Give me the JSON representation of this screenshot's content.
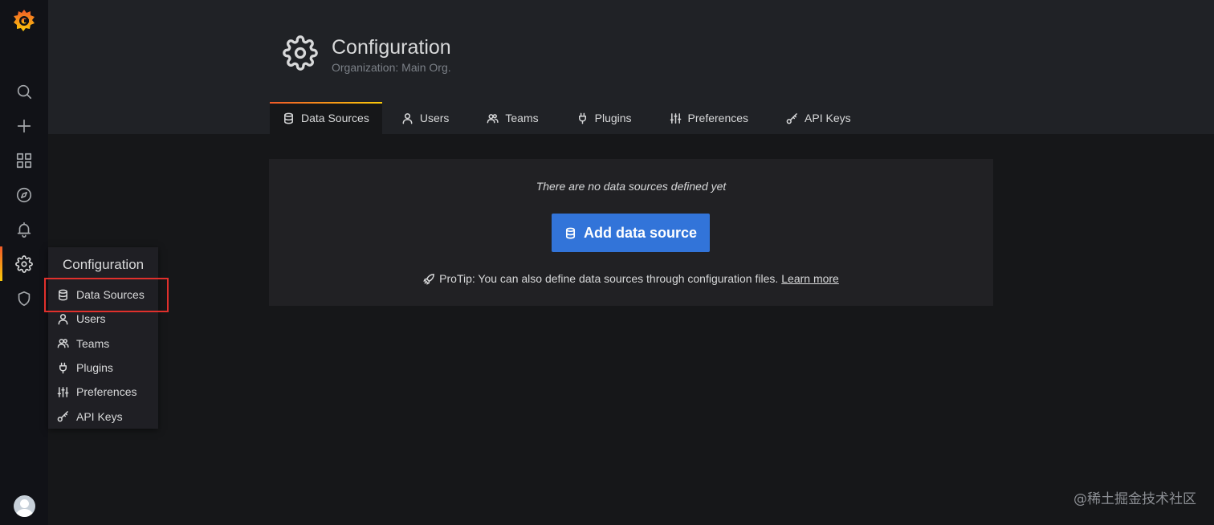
{
  "header": {
    "title": "Configuration",
    "subtitle": "Organization: Main Org."
  },
  "tabs": [
    {
      "label": "Data Sources",
      "icon": "database-icon",
      "active": true
    },
    {
      "label": "Users",
      "icon": "user-icon"
    },
    {
      "label": "Teams",
      "icon": "users-icon"
    },
    {
      "label": "Plugins",
      "icon": "plug-icon"
    },
    {
      "label": "Preferences",
      "icon": "sliders-icon"
    },
    {
      "label": "API Keys",
      "icon": "key-icon"
    }
  ],
  "empty_state": {
    "message": "There are no data sources defined yet",
    "button_label": "Add data source",
    "protip": "ProTip: You can also define data sources through configuration files.",
    "learn_more": "Learn more"
  },
  "sidebar": {
    "items": [
      "search-icon",
      "plus-icon",
      "dashboards-icon",
      "explore-icon",
      "alert-bell-icon",
      "gear-icon",
      "shield-icon"
    ],
    "active": "gear-icon"
  },
  "flyout": {
    "title": "Configuration",
    "items": [
      {
        "label": "Data Sources",
        "icon": "database-icon"
      },
      {
        "label": "Users",
        "icon": "user-icon"
      },
      {
        "label": "Teams",
        "icon": "users-icon"
      },
      {
        "label": "Plugins",
        "icon": "plug-icon"
      },
      {
        "label": "Preferences",
        "icon": "sliders-icon"
      },
      {
        "label": "API Keys",
        "icon": "key-icon"
      }
    ]
  },
  "watermark": "@稀土掘金技术社区",
  "colors": {
    "primary_button": "#3274d9",
    "accent_gradient_start": "#f05a28",
    "accent_gradient_end": "#fbca0a",
    "highlight_box": "#e0302c"
  }
}
